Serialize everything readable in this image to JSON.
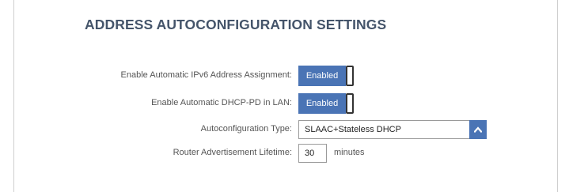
{
  "section": {
    "title": "ADDRESS AUTOCONFIGURATION SETTINGS"
  },
  "fields": {
    "auto_ipv6": {
      "label": "Enable Automatic IPv6 Address Assignment:",
      "value": "Enabled"
    },
    "auto_dhcp_pd": {
      "label": "Enable Automatic DHCP-PD in LAN:",
      "value": "Enabled"
    },
    "autoconfig_type": {
      "label": "Autoconfiguration Type:",
      "value": "SLAAC+Stateless DHCP"
    },
    "ra_lifetime": {
      "label": "Router Advertisement Lifetime:",
      "value": "30",
      "unit": "minutes"
    }
  },
  "icons": {
    "dropdown": "chevron-up-icon"
  },
  "colors": {
    "accent": "#4a74b5",
    "title": "#44546a"
  }
}
